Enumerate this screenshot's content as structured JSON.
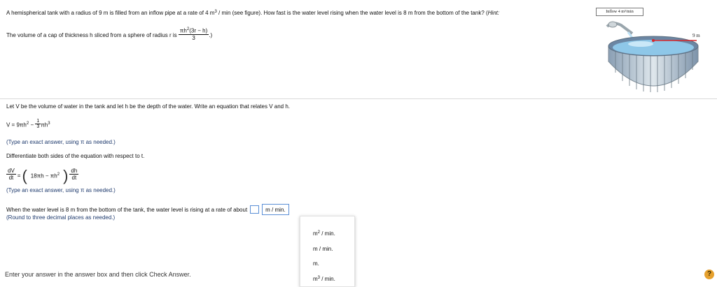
{
  "problem": {
    "text_a": "A hemispherical tank with a radius of 9 m is filled from an inflow pipe at a rate of 4 m",
    "sup_a": "3",
    "text_b": " / min (see figure). How fast is the water level rising when the water level is 8 m from the bottom of the tank? (",
    "hint_word": "Hint:",
    "vol_text": "The volume of a cap of thickness h sliced from a sphere of radius r is",
    "vol_num_a": "πh",
    "vol_num_sup": "2",
    "vol_num_b": "(3r − h)",
    "vol_den": "3",
    "vol_close": ".)"
  },
  "figure": {
    "inflow_label": "Inflow 4 m³/min",
    "radius_label": "9 m",
    "colors": {
      "water": "#8ec7e8",
      "tank_outer": "#c6d3da",
      "tank_inner": "#6b86a3",
      "radius_line": "#d7262b"
    }
  },
  "question1": "Let V be the volume of water in the tank and let h be the depth of the water. Write an equation that relates V and h.",
  "eq1": {
    "lhs": "V = 9πh",
    "sup": "2",
    "minus": "−",
    "frac_num": "1",
    "frac_den": "3",
    "term": "πh",
    "term_sup": "3"
  },
  "note1": "(Type an exact answer, using π as needed.)",
  "instruction_diff": "Differentiate both sides of the equation with respect to t.",
  "eq2": {
    "dv": "dV",
    "dt1": "dt",
    "equals": "=",
    "inner_a": "18πh − πh",
    "inner_sup": "2",
    "dh": "dh",
    "dt2": "dt"
  },
  "note2": "(Type an exact answer, using π as needed.)",
  "rate_question": "When the water level is 8 m from the bottom of the tank, the water level is rising at a rate of about",
  "selected_unit": "m / min.",
  "note3": "(Round to three decimal places as needed.)",
  "dropdown": {
    "options": [
      {
        "base": "m",
        "sup": "2",
        "rest": " / min."
      },
      {
        "base": "m / min.",
        "sup": "",
        "rest": ""
      },
      {
        "base": "m.",
        "sup": "",
        "rest": ""
      },
      {
        "base": "m",
        "sup": "3",
        "rest": " / min."
      }
    ]
  },
  "footer": "Enter your answer in the answer box and then click Check Answer.",
  "help_label": "?"
}
